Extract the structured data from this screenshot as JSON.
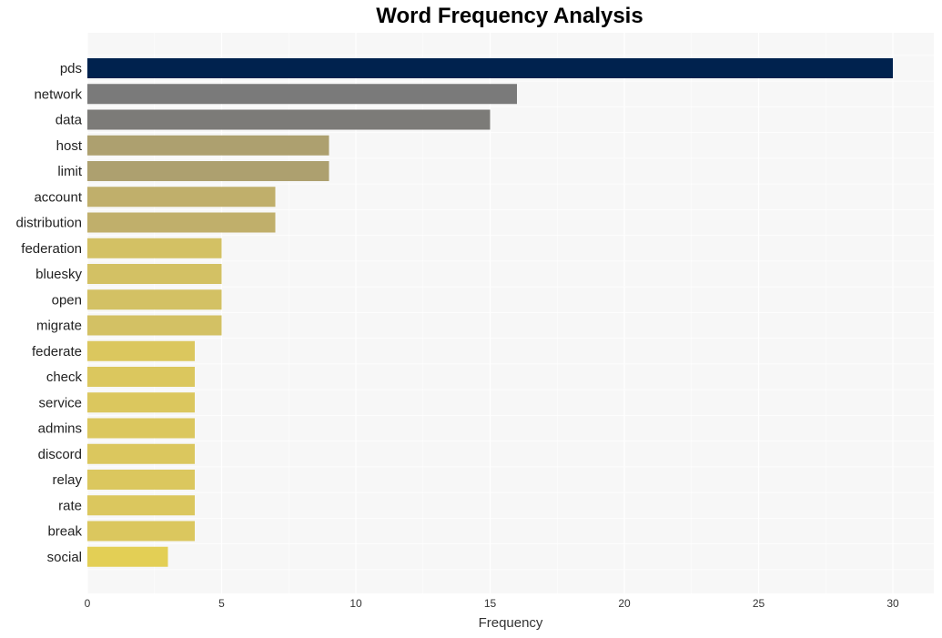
{
  "chart_data": {
    "type": "bar",
    "orientation": "horizontal",
    "title": "Word Frequency Analysis",
    "xlabel": "Frequency",
    "ylabel": "",
    "xlim": [
      0,
      31.5
    ],
    "xticks": [
      0,
      5,
      10,
      15,
      20,
      25,
      30
    ],
    "grid": true,
    "categories": [
      "pds",
      "network",
      "data",
      "host",
      "limit",
      "account",
      "distribution",
      "federation",
      "bluesky",
      "open",
      "migrate",
      "federate",
      "check",
      "service",
      "admins",
      "discord",
      "relay",
      "rate",
      "break",
      "social"
    ],
    "values": [
      30,
      16,
      15,
      9,
      9,
      7,
      7,
      5,
      5,
      5,
      5,
      4,
      4,
      4,
      4,
      4,
      4,
      4,
      4,
      3
    ],
    "colors": [
      "#00224e",
      "#7a7a7a",
      "#7c7b78",
      "#ada06f",
      "#ada06f",
      "#c0af6b",
      "#c0af6b",
      "#d3c164",
      "#d3c164",
      "#d3c164",
      "#d3c164",
      "#dbc75e",
      "#dbc75e",
      "#dbc75e",
      "#dbc75e",
      "#dbc75e",
      "#dbc75e",
      "#dbc75e",
      "#dbc75e",
      "#e3cf55"
    ]
  }
}
